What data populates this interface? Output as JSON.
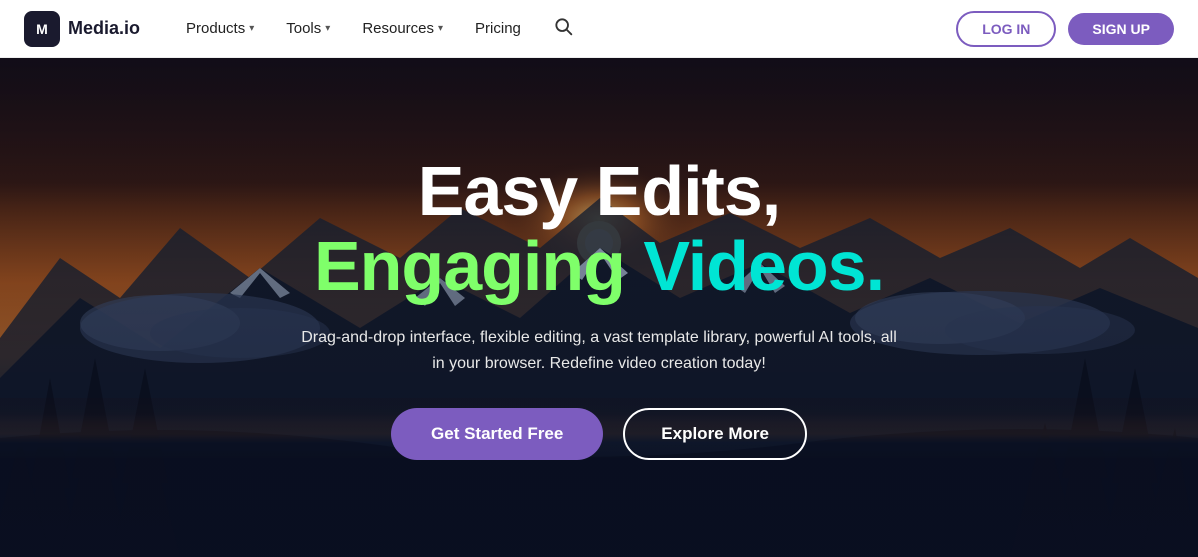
{
  "brand": {
    "logo_text": "Media.io",
    "logo_icon": "M"
  },
  "nav": {
    "items": [
      {
        "label": "Products",
        "has_dropdown": true
      },
      {
        "label": "Tools",
        "has_dropdown": true
      },
      {
        "label": "Resources",
        "has_dropdown": true
      },
      {
        "label": "Pricing",
        "has_dropdown": false
      }
    ]
  },
  "actions": {
    "login_label": "LOG IN",
    "signup_label": "SIGN UP"
  },
  "hero": {
    "title_line1": "Easy Edits,",
    "title_line2_green": "Engaging",
    "title_line2_cyan": "Videos.",
    "subtitle": "Drag-and-drop interface, flexible editing, a vast template library, powerful AI tools, all in your browser. Redefine video creation today!",
    "cta_primary": "Get Started Free",
    "cta_secondary": "Explore More"
  },
  "colors": {
    "purple": "#7c5cbf",
    "green": "#7fff6a",
    "cyan": "#00e5d4",
    "white": "#ffffff"
  }
}
